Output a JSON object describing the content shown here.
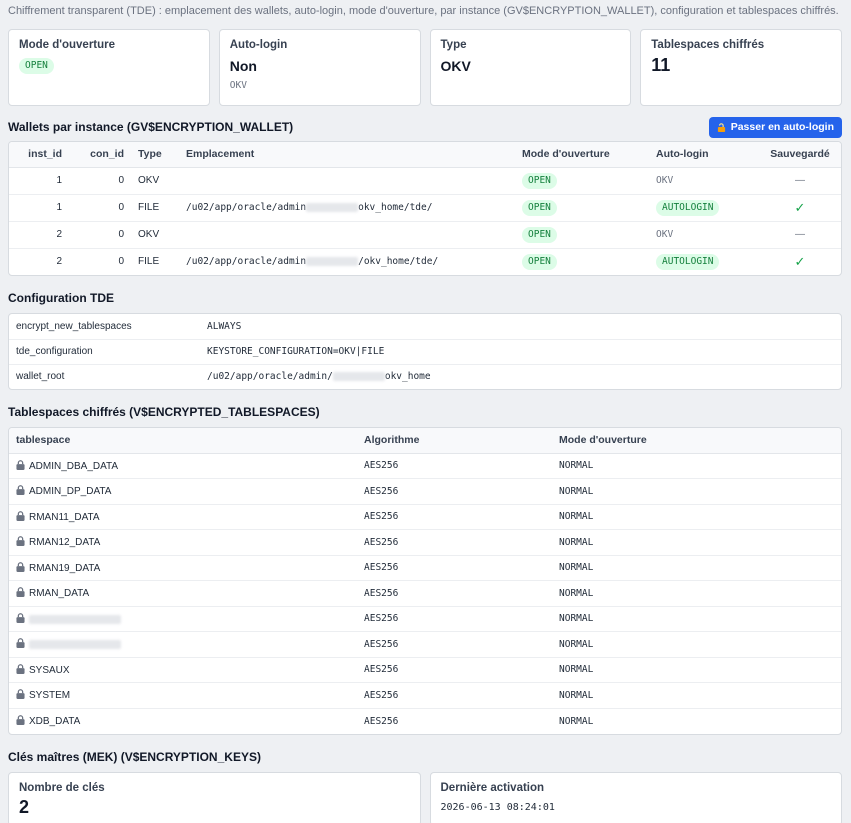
{
  "description": "Chiffrement transparent (TDE) : emplacement des wallets, auto-login, mode d'ouverture, par instance (GV$ENCRYPTION_WALLET), configuration et tablespaces chiffrés.",
  "summary": {
    "mode": {
      "label": "Mode d'ouverture",
      "badge": "OPEN"
    },
    "autologin": {
      "label": "Auto-login",
      "value": "Non",
      "sub": "OKV"
    },
    "type": {
      "label": "Type",
      "value": "OKV"
    },
    "tablespaces": {
      "label": "Tablespaces chiffrés",
      "value": "11"
    }
  },
  "wallets": {
    "title": "Wallets par instance (GV$ENCRYPTION_WALLET)",
    "button": "Passer en auto-login",
    "columns": [
      "inst_id",
      "con_id",
      "Type",
      "Emplacement",
      "Mode d'ouverture",
      "Auto-login",
      "Sauvegardé"
    ],
    "rows": [
      {
        "inst_id": "1",
        "con_id": "0",
        "type": "OKV",
        "loc_pre": "",
        "loc_post": "",
        "mode": "OPEN",
        "autologin": "OKV",
        "saved": "—"
      },
      {
        "inst_id": "1",
        "con_id": "0",
        "type": "FILE",
        "loc_pre": "/u02/app/oracle/admin",
        "loc_post": "okv_home/tde/",
        "mode": "OPEN",
        "autologin": "AUTOLOGIN",
        "saved": "✓"
      },
      {
        "inst_id": "2",
        "con_id": "0",
        "type": "OKV",
        "loc_pre": "",
        "loc_post": "",
        "mode": "OPEN",
        "autologin": "OKV",
        "saved": "—"
      },
      {
        "inst_id": "2",
        "con_id": "0",
        "type": "FILE",
        "loc_pre": "/u02/app/oracle/admin",
        "loc_post": "/okv_home/tde/",
        "mode": "OPEN",
        "autologin": "AUTOLOGIN",
        "saved": "✓"
      }
    ]
  },
  "config": {
    "title": "Configuration TDE",
    "rows": [
      {
        "key": "encrypt_new_tablespaces",
        "pre": "ALWAYS",
        "post": ""
      },
      {
        "key": "tde_configuration",
        "pre": "KEYSTORE_CONFIGURATION=OKV|FILE",
        "post": ""
      },
      {
        "key": "wallet_root",
        "pre": "/u02/app/oracle/admin/",
        "post": "okv_home"
      }
    ]
  },
  "tablespaces": {
    "title": "Tablespaces chiffrés (V$ENCRYPTED_TABLESPACES)",
    "columns": [
      "tablespace",
      "Algorithme",
      "Mode d'ouverture"
    ],
    "rows": [
      {
        "name": "ADMIN_DBA_DATA",
        "algo": "AES256",
        "mode": "NORMAL"
      },
      {
        "name": "ADMIN_DP_DATA",
        "algo": "AES256",
        "mode": "NORMAL"
      },
      {
        "name": "RMAN11_DATA",
        "algo": "AES256",
        "mode": "NORMAL"
      },
      {
        "name": "RMAN12_DATA",
        "algo": "AES256",
        "mode": "NORMAL"
      },
      {
        "name": "RMAN19_DATA",
        "algo": "AES256",
        "mode": "NORMAL"
      },
      {
        "name": "RMAN_DATA",
        "algo": "AES256",
        "mode": "NORMAL"
      },
      {
        "name": "",
        "algo": "AES256",
        "mode": "NORMAL"
      },
      {
        "name": "",
        "algo": "AES256",
        "mode": "NORMAL"
      },
      {
        "name": "SYSAUX",
        "algo": "AES256",
        "mode": "NORMAL"
      },
      {
        "name": "SYSTEM",
        "algo": "AES256",
        "mode": "NORMAL"
      },
      {
        "name": "XDB_DATA",
        "algo": "AES256",
        "mode": "NORMAL"
      }
    ]
  },
  "keys": {
    "title": "Clés maîtres (MEK) (V$ENCRYPTION_KEYS)",
    "count": {
      "label": "Nombre de clés",
      "value": "2"
    },
    "last": {
      "label": "Dernière activation",
      "value": "2026-06-13 08:24:01"
    }
  },
  "colors": {
    "accent": "#2563eb",
    "success_bg": "#dcfce7",
    "success_fg": "#15803d"
  }
}
